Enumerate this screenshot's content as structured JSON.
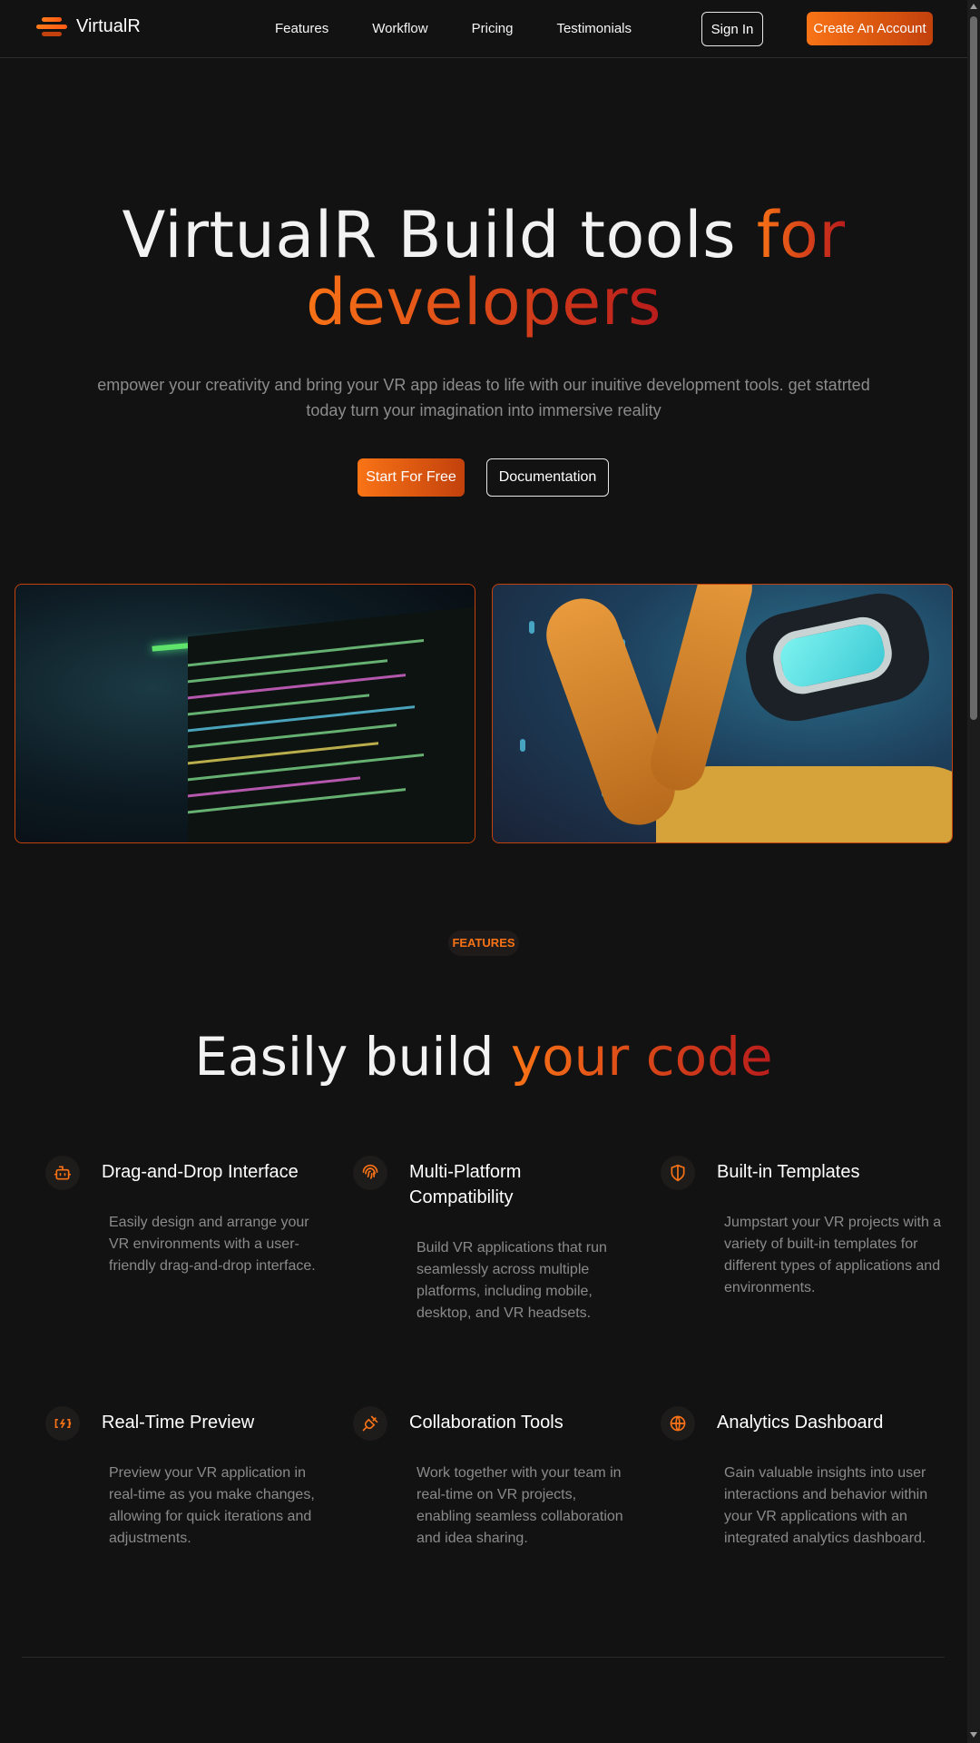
{
  "brand": {
    "name": "VirtualR"
  },
  "nav": {
    "links": [
      "Features",
      "Workflow",
      "Pricing",
      "Testimonials"
    ],
    "signin_label": "Sign In",
    "create_label": "Create An Account"
  },
  "hero": {
    "title_plain": "VirtualR Build tools ",
    "title_accent_1": "for",
    "title_accent_2": "developers",
    "subtitle": "empower your creativity and bring your VR app ideas to life with our inuitive development tools. get statrted today turn your imagination into immersive reality",
    "primary_cta": "Start For Free",
    "secondary_cta": "Documentation"
  },
  "features": {
    "badge": "FEATURES",
    "title_plain": "Easily build ",
    "title_accent": "your code",
    "items": [
      {
        "icon": "bot-icon",
        "title": "Drag-and-Drop Interface",
        "desc": "Easily design and arrange your VR environments with a user-friendly drag-and-drop interface."
      },
      {
        "icon": "fingerprint-icon",
        "title": "Multi-Platform Compatibility",
        "desc": "Build VR applications that run seamlessly across multiple platforms, including mobile, desktop, and VR headsets."
      },
      {
        "icon": "shield-icon",
        "title": "Built-in Templates",
        "desc": "Jumpstart your VR projects with a variety of built-in templates for different types of applications and environments."
      },
      {
        "icon": "battery-charging-icon",
        "title": "Real-Time Preview",
        "desc": "Preview your VR application in real-time as you make changes, allowing for quick iterations and adjustments."
      },
      {
        "icon": "plug-icon",
        "title": "Collaboration Tools",
        "desc": "Work together with your team in real-time on VR projects, enabling seamless collaboration and idea sharing."
      },
      {
        "icon": "globe-icon",
        "title": "Analytics Dashboard",
        "desc": "Gain valuable insights into user interactions and behavior within your VR applications with an integrated analytics dashboard."
      }
    ]
  },
  "colors": {
    "accent": "#f97316",
    "accent_dark": "#b91c1c",
    "background": "#131213"
  }
}
